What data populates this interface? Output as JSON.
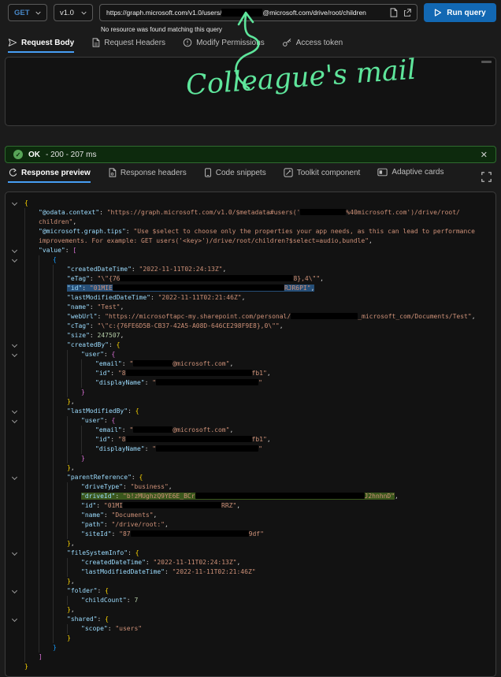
{
  "topbar": {
    "method": "GET",
    "version": "v1.0",
    "url_prefix": "https://graph.microsoft.com/v1.0/users/",
    "url_suffix": "@microsoft.com/drive/root/children",
    "run_label": "Run query",
    "hint": "No resource was found matching this query"
  },
  "annotation": {
    "text": "Colleague's mail",
    "color": "#5ee59b"
  },
  "request_tabs": {
    "active": "Request Body",
    "items": [
      {
        "label": "Request Body"
      },
      {
        "label": "Request Headers"
      },
      {
        "label": "Modify Permissions"
      },
      {
        "label": "Access token"
      }
    ]
  },
  "status": {
    "label": "OK",
    "detail": "- 200 - 207 ms",
    "close": "✕"
  },
  "response_tabs": {
    "active": "Response preview",
    "items": [
      {
        "label": "Response preview"
      },
      {
        "label": "Response headers"
      },
      {
        "label": "Code snippets"
      },
      {
        "label": "Toolkit component"
      },
      {
        "label": "Adaptive cards"
      }
    ]
  },
  "syntax_colors": {
    "key": "#9cdcfe",
    "string": "#ce9178",
    "number": "#b5cea8",
    "punct": "#d4d4d4",
    "bracket1": "#ffd700",
    "bracket2": "#da70d6",
    "bracket3": "#179fff"
  },
  "response": {
    "lines": [
      {
        "i": 0,
        "c": 1,
        "t": [
          [
            "b1",
            "{"
          ]
        ]
      },
      {
        "i": 1,
        "t": [
          [
            "k",
            "\"@odata.context\""
          ],
          [
            "p",
            ": "
          ],
          [
            "s",
            "\"https://graph.microsoft.com/v1.0/$metadata#users('"
          ],
          [
            "r",
            58
          ],
          [
            "s",
            "%40microsoft.com')/drive/root/"
          ]
        ]
      },
      {
        "i": 1,
        "t": [
          [
            "s",
            "children\""
          ],
          [
            "p",
            ","
          ]
        ]
      },
      {
        "i": 1,
        "t": [
          [
            "k",
            "\"@microsoft.graph.tips\""
          ],
          [
            "p",
            ": "
          ],
          [
            "s",
            "\"Use $select to choose only the properties your app needs, as this can lead to performance"
          ]
        ]
      },
      {
        "i": 1,
        "t": [
          [
            "s",
            "improvements. For example: GET users('<key>')/drive/root/children?$select=audio,bundle\""
          ],
          [
            "p",
            ","
          ]
        ]
      },
      {
        "i": 1,
        "c": 1,
        "t": [
          [
            "k",
            "\"value\""
          ],
          [
            "p",
            ": "
          ],
          [
            "b2",
            "["
          ]
        ]
      },
      {
        "i": 2,
        "c": 1,
        "t": [
          [
            "b3",
            "{"
          ]
        ]
      },
      {
        "i": 3,
        "t": [
          [
            "k",
            "\"createdDateTime\""
          ],
          [
            "p",
            ": "
          ],
          [
            "s",
            "\"2022-11-11T02:24:13Z\""
          ],
          [
            "p",
            ","
          ]
        ]
      },
      {
        "i": 3,
        "t": [
          [
            "k",
            "\"eTag\""
          ],
          [
            "p",
            ": "
          ],
          [
            "s",
            "\"\\\"{76"
          ],
          [
            "r",
            220
          ],
          [
            "s",
            "8},4\\\"\""
          ],
          [
            "p",
            ","
          ]
        ]
      },
      {
        "i": 3,
        "h": "sel",
        "t": [
          [
            "k",
            "\"id\""
          ],
          [
            "p",
            ": "
          ],
          [
            "s",
            "\"01MIE"
          ],
          [
            "r",
            218
          ],
          [
            "s",
            "RJR6PI\""
          ],
          [
            "p",
            ","
          ]
        ]
      },
      {
        "i": 3,
        "t": [
          [
            "k",
            "\"lastModifiedDateTime\""
          ],
          [
            "p",
            ": "
          ],
          [
            "s",
            "\"2022-11-11T02:21:46Z\""
          ],
          [
            "p",
            ","
          ]
        ]
      },
      {
        "i": 3,
        "t": [
          [
            "k",
            "\"name\""
          ],
          [
            "p",
            ": "
          ],
          [
            "s",
            "\"Test\""
          ],
          [
            "p",
            ","
          ]
        ]
      },
      {
        "i": 3,
        "t": [
          [
            "k",
            "\"webUrl\""
          ],
          [
            "p",
            ": "
          ],
          [
            "s",
            "\"https://microsoftapc-my.sharepoint.com/personal/"
          ],
          [
            "r",
            85
          ],
          [
            "s",
            "_microsoft_com/Documents/Test\""
          ],
          [
            "p",
            ","
          ]
        ]
      },
      {
        "i": 3,
        "t": [
          [
            "k",
            "\"cTag\""
          ],
          [
            "p",
            ": "
          ],
          [
            "s",
            "\"\\\"c:{76FE6D5B-CB37-42A5-A08D-646CE298F9E8},0\\\"\""
          ],
          [
            "p",
            ","
          ]
        ]
      },
      {
        "i": 3,
        "t": [
          [
            "k",
            "\"size\""
          ],
          [
            "p",
            ": "
          ],
          [
            "n",
            "247507"
          ],
          [
            "p",
            ","
          ]
        ]
      },
      {
        "i": 3,
        "c": 1,
        "t": [
          [
            "k",
            "\"createdBy\""
          ],
          [
            "p",
            ": "
          ],
          [
            "b1",
            "{"
          ]
        ]
      },
      {
        "i": 4,
        "c": 1,
        "t": [
          [
            "k",
            "\"user\""
          ],
          [
            "p",
            ": "
          ],
          [
            "b2",
            "{"
          ]
        ]
      },
      {
        "i": 5,
        "t": [
          [
            "k",
            "\"email\""
          ],
          [
            "p",
            ": "
          ],
          [
            "s",
            "\""
          ],
          [
            "r",
            50
          ],
          [
            "s",
            "@microsoft.com\""
          ],
          [
            "p",
            ","
          ]
        ]
      },
      {
        "i": 5,
        "t": [
          [
            "k",
            "\"id\""
          ],
          [
            "p",
            ": "
          ],
          [
            "s",
            "\"8"
          ],
          [
            "r",
            160
          ],
          [
            "s",
            "fb1\""
          ],
          [
            "p",
            ","
          ]
        ]
      },
      {
        "i": 5,
        "t": [
          [
            "k",
            "\"displayName\""
          ],
          [
            "p",
            ": "
          ],
          [
            "s",
            "\""
          ],
          [
            "r",
            130
          ],
          [
            "s",
            "\""
          ]
        ]
      },
      {
        "i": 4,
        "t": [
          [
            "b2",
            "}"
          ]
        ]
      },
      {
        "i": 3,
        "t": [
          [
            "b1",
            "}"
          ],
          [
            "p",
            ","
          ]
        ]
      },
      {
        "i": 3,
        "c": 1,
        "t": [
          [
            "k",
            "\"lastModifiedBy\""
          ],
          [
            "p",
            ": "
          ],
          [
            "b1",
            "{"
          ]
        ]
      },
      {
        "i": 4,
        "c": 1,
        "t": [
          [
            "k",
            "\"user\""
          ],
          [
            "p",
            ": "
          ],
          [
            "b2",
            "{"
          ]
        ]
      },
      {
        "i": 5,
        "t": [
          [
            "k",
            "\"email\""
          ],
          [
            "p",
            ": "
          ],
          [
            "s",
            "\""
          ],
          [
            "r",
            50
          ],
          [
            "s",
            "@microsoft.com\""
          ],
          [
            "p",
            ","
          ]
        ]
      },
      {
        "i": 5,
        "t": [
          [
            "k",
            "\"id\""
          ],
          [
            "p",
            ": "
          ],
          [
            "s",
            "\"8"
          ],
          [
            "r",
            160
          ],
          [
            "s",
            "fb1\""
          ],
          [
            "p",
            ","
          ]
        ]
      },
      {
        "i": 5,
        "t": [
          [
            "k",
            "\"displayName\""
          ],
          [
            "p",
            ": "
          ],
          [
            "s",
            "\""
          ],
          [
            "r",
            130
          ],
          [
            "s",
            "\""
          ]
        ]
      },
      {
        "i": 4,
        "t": [
          [
            "b2",
            "}"
          ]
        ]
      },
      {
        "i": 3,
        "t": [
          [
            "b1",
            "}"
          ],
          [
            "p",
            ","
          ]
        ]
      },
      {
        "i": 3,
        "c": 1,
        "t": [
          [
            "k",
            "\"parentReference\""
          ],
          [
            "p",
            ": "
          ],
          [
            "b1",
            "{"
          ]
        ]
      },
      {
        "i": 4,
        "t": [
          [
            "k",
            "\"driveType\""
          ],
          [
            "p",
            ": "
          ],
          [
            "s",
            "\"business\""
          ],
          [
            "p",
            ","
          ]
        ]
      },
      {
        "i": 4,
        "h": "grn",
        "hx": 1,
        "t": [
          [
            "k",
            "\"driveId\""
          ],
          [
            "p",
            ": "
          ],
          [
            "s",
            "\"b!zMUghzQ9YE6E_BCr"
          ],
          [
            "r",
            215
          ],
          [
            "s",
            "J2hnhnD\""
          ],
          [
            "p",
            ","
          ]
        ]
      },
      {
        "i": 4,
        "t": [
          [
            "k",
            "\"id\""
          ],
          [
            "p",
            ": "
          ],
          [
            "s",
            "\"01MI"
          ],
          [
            "r",
            125
          ],
          [
            "s",
            "RRZ\""
          ],
          [
            "p",
            ","
          ]
        ]
      },
      {
        "i": 4,
        "t": [
          [
            "k",
            "\"name\""
          ],
          [
            "p",
            ": "
          ],
          [
            "s",
            "\"Documents\""
          ],
          [
            "p",
            ","
          ]
        ]
      },
      {
        "i": 4,
        "t": [
          [
            "k",
            "\"path\""
          ],
          [
            "p",
            ": "
          ],
          [
            "s",
            "\"/drive/root:\""
          ],
          [
            "p",
            ","
          ]
        ]
      },
      {
        "i": 4,
        "t": [
          [
            "k",
            "\"siteId\""
          ],
          [
            "p",
            ": "
          ],
          [
            "s",
            "\"87"
          ],
          [
            "r",
            150
          ],
          [
            "s",
            "9df\""
          ]
        ]
      },
      {
        "i": 3,
        "t": [
          [
            "b1",
            "}"
          ],
          [
            "p",
            ","
          ]
        ]
      },
      {
        "i": 3,
        "c": 1,
        "t": [
          [
            "k",
            "\"fileSystemInfo\""
          ],
          [
            "p",
            ": "
          ],
          [
            "b1",
            "{"
          ]
        ]
      },
      {
        "i": 4,
        "t": [
          [
            "k",
            "\"createdDateTime\""
          ],
          [
            "p",
            ": "
          ],
          [
            "s",
            "\"2022-11-11T02:24:13Z\""
          ],
          [
            "p",
            ","
          ]
        ]
      },
      {
        "i": 4,
        "t": [
          [
            "k",
            "\"lastModifiedDateTime\""
          ],
          [
            "p",
            ": "
          ],
          [
            "s",
            "\"2022-11-11T02:21:46Z\""
          ]
        ]
      },
      {
        "i": 3,
        "t": [
          [
            "b1",
            "}"
          ],
          [
            "p",
            ","
          ]
        ]
      },
      {
        "i": 3,
        "c": 1,
        "t": [
          [
            "k",
            "\"folder\""
          ],
          [
            "p",
            ": "
          ],
          [
            "b1",
            "{"
          ]
        ]
      },
      {
        "i": 4,
        "t": [
          [
            "k",
            "\"childCount\""
          ],
          [
            "p",
            ": "
          ],
          [
            "n",
            "7"
          ]
        ]
      },
      {
        "i": 3,
        "t": [
          [
            "b1",
            "}"
          ],
          [
            "p",
            ","
          ]
        ]
      },
      {
        "i": 3,
        "c": 1,
        "t": [
          [
            "k",
            "\"shared\""
          ],
          [
            "p",
            ": "
          ],
          [
            "b1",
            "{"
          ]
        ]
      },
      {
        "i": 4,
        "t": [
          [
            "k",
            "\"scope\""
          ],
          [
            "p",
            ": "
          ],
          [
            "s",
            "\"users\""
          ]
        ]
      },
      {
        "i": 3,
        "t": [
          [
            "b1",
            "}"
          ]
        ]
      },
      {
        "i": 2,
        "t": [
          [
            "b3",
            "}"
          ]
        ]
      },
      {
        "i": 1,
        "t": [
          [
            "b2",
            "]"
          ]
        ]
      },
      {
        "i": 0,
        "t": [
          [
            "b1",
            "}"
          ]
        ]
      }
    ]
  }
}
